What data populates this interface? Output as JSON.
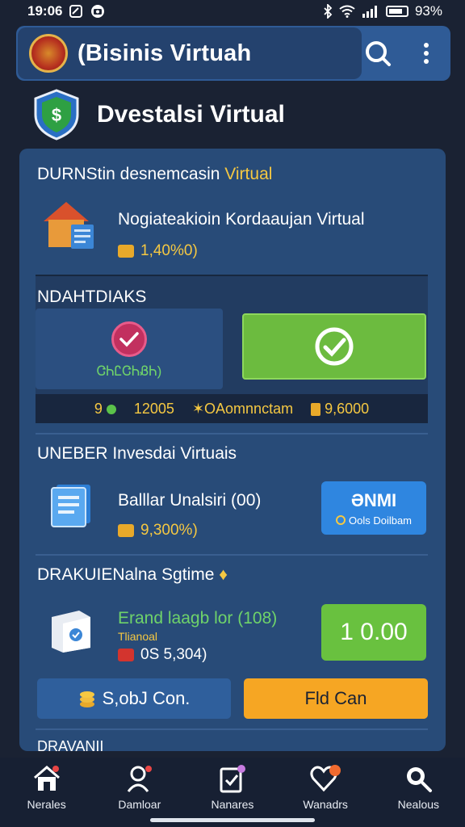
{
  "status": {
    "time": "19:06",
    "battery": "93%"
  },
  "app_bar": {
    "title": "(Bisinis Virtuah"
  },
  "page": {
    "title": "Dvestalsi Virtual"
  },
  "section1": {
    "title_main": "DURNStin desnemcasin ",
    "title_accent": "Virtual",
    "item_title": "Nogiateakioin Kordaaujan Virtual",
    "item_value": "1,40%0)"
  },
  "section2": {
    "title": "NDAHTDIAKS",
    "left_tile_label": "ᏣᏂᏝᏣᏂᏰᏂ)",
    "footer": {
      "a": "9",
      "b": "12005",
      "c": "OAomnnctam",
      "d": "9,6000"
    }
  },
  "section3": {
    "title": "UNEBER Invesdai Virtuais",
    "item_title": "Balllar Unalsiri (00)",
    "item_value": "9,300%)",
    "button_top": "ƏNMI",
    "button_bottom": "Ools Doilbam"
  },
  "section4": {
    "title": "DRAKUIENalna Sgtime",
    "item_title": "Erand laagb lor (108)",
    "item_subtitle": "Tlianoal",
    "item_value": "0S 5,304)",
    "value_button": "1 0.00"
  },
  "buttons": {
    "left_label": "S,obJ Con.",
    "right_label": "Fld Can"
  },
  "section5": {
    "title": "DRAVANII"
  },
  "nav": {
    "items": [
      {
        "label": "Nerales"
      },
      {
        "label": "Damloar"
      },
      {
        "label": "Nanares"
      },
      {
        "label": "Wanadrs"
      },
      {
        "label": "Nealous"
      }
    ]
  },
  "colors": {
    "background": "#1a2233",
    "app_bar": "#2f5b96",
    "card": "#284b78",
    "accent_yellow": "#f5c842",
    "accent_green": "#6cbb3f",
    "accent_blue": "#2f86e0",
    "accent_orange": "#f6a623"
  },
  "icons": {
    "status": [
      "camera-icon",
      "bluetooth-icon",
      "wifi-icon",
      "signal-icon",
      "battery-icon"
    ],
    "app_bar": [
      "logo-emblem-icon",
      "search-icon",
      "more-vertical-icon"
    ],
    "nav": [
      "home-icon",
      "person-icon",
      "document-check-icon",
      "heart-icon",
      "search-icon"
    ]
  }
}
